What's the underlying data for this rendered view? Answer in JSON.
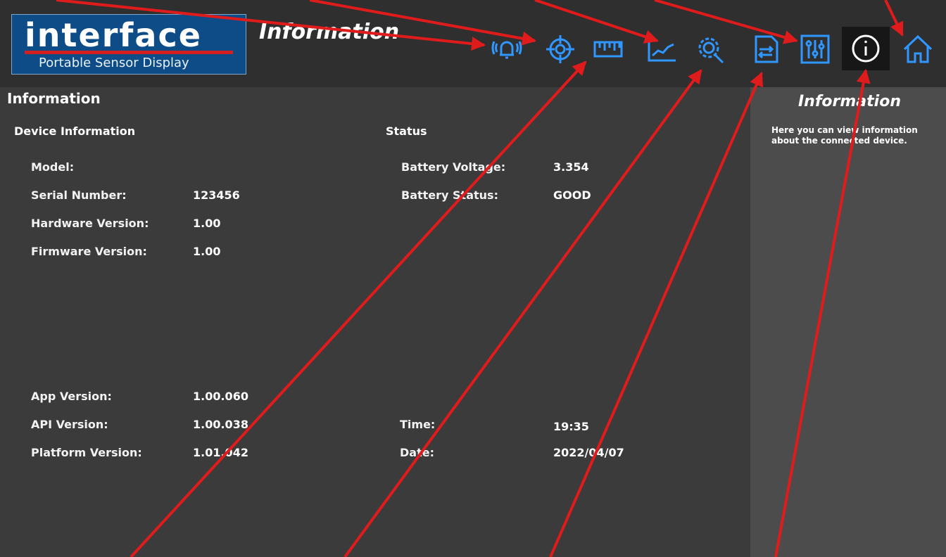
{
  "brand": {
    "logo_text": "interface",
    "subtitle": "Portable Sensor Display"
  },
  "header": {
    "title": "Information"
  },
  "toolbar": {
    "icons": [
      "alarm-icon",
      "target-icon",
      "ruler-icon",
      "chart-icon",
      "settings-icon",
      "file-transfer-icon",
      "sliders-icon",
      "info-icon",
      "home-icon"
    ],
    "selected": "info-icon",
    "accent": "#2f97ff"
  },
  "content": {
    "page_title": "Information",
    "device_info": {
      "heading": "Device Information",
      "fields": [
        {
          "label": "Model:",
          "value": ""
        },
        {
          "label": "Serial Number:",
          "value": "123456"
        },
        {
          "label": "Hardware Version:",
          "value": "1.00"
        },
        {
          "label": "Firmware Version:",
          "value": "1.00"
        }
      ]
    },
    "status": {
      "heading": "Status",
      "fields": [
        {
          "label": "Battery Voltage:",
          "value": "3.354"
        },
        {
          "label": "Battery Status:",
          "value": "GOOD"
        }
      ]
    },
    "versions": [
      {
        "label": "App Version:",
        "value": "1.00.060"
      },
      {
        "label": "API Version:",
        "value": "1.00.038"
      },
      {
        "label": "Platform Version:",
        "value": "1.01.042"
      }
    ],
    "datetime": [
      {
        "label": "Time:",
        "value": "19:35"
      },
      {
        "label": "Date:",
        "value": "2022/04/07"
      }
    ]
  },
  "help": {
    "title": "Information",
    "text": "Here you can view information about the connected device."
  },
  "colors": {
    "annotation_arrow": "#e01b1b",
    "panel_bg": "#3b3b3b",
    "help_bg": "#4c4c4c"
  }
}
